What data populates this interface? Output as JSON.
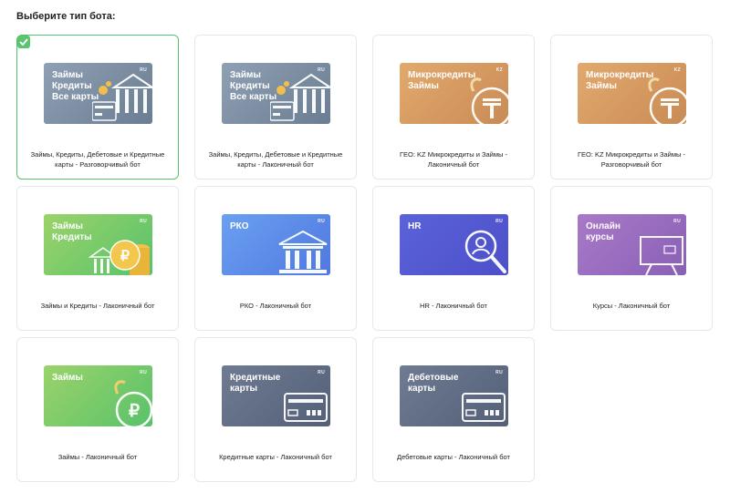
{
  "page": {
    "title": "Выберите тип бота:"
  },
  "colors": {
    "selected_border": "#57c26a",
    "check_bg": "#5cc36f"
  },
  "cards": [
    {
      "banner_title": "Займы\nКредиты\nВсе карты",
      "tag": "RU",
      "caption": "Займы, Кредиты, Дебетовые и Кредитные карты - Разговорчивый бот",
      "theme": "slate",
      "icon": "bank-card-coin-icon",
      "selected": true
    },
    {
      "banner_title": "Займы\nКредиты\nВсе карты",
      "tag": "RU",
      "caption": "Займы, Кредиты, Дебетовые и Кредитные карты - Лаконичный бот",
      "theme": "slate",
      "icon": "bank-card-coin-icon",
      "selected": false
    },
    {
      "banner_title": "Микрокредиты\nЗаймы",
      "tag": "KZ",
      "caption": "ГЕО: KZ Микрокредиты и Займы - Лаконичный бот",
      "theme": "orange",
      "icon": "tenge-coin-icon",
      "selected": false
    },
    {
      "banner_title": "Микрокредиты\nЗаймы",
      "tag": "KZ",
      "caption": "ГЕО: KZ Микрокредиты и Займы - Разговорчивый бот",
      "theme": "orange",
      "icon": "tenge-coin-icon",
      "selected": false
    },
    {
      "banner_title": "Займы\nКредиты",
      "tag": "RU",
      "caption": "Займы и Кредиты - Лаконичный бот",
      "theme": "green",
      "icon": "ruble-coin-stack-icon",
      "selected": false
    },
    {
      "banner_title": "РКО",
      "tag": "RU",
      "caption": "РКО - Лаконичный бот",
      "theme": "blue",
      "icon": "bank-building-icon",
      "selected": false
    },
    {
      "banner_title": "HR",
      "tag": "RU",
      "caption": "HR - Лаконичный бот",
      "theme": "indigo",
      "icon": "magnifier-person-icon",
      "selected": false
    },
    {
      "banner_title": "Онлайн\nкурсы",
      "tag": "RU",
      "caption": "Курсы - Лаконичный бот",
      "theme": "purple",
      "icon": "presentation-board-icon",
      "selected": false
    },
    {
      "banner_title": "Займы",
      "tag": "RU",
      "caption": "Займы - Лаконичный бот",
      "theme": "green",
      "icon": "ruble-coin-icon",
      "selected": false
    },
    {
      "banner_title": "Кредитные\nкарты",
      "tag": "RU",
      "caption": "Кредитные карты - Лаконичный бот",
      "theme": "dark",
      "icon": "credit-card-icon",
      "selected": false
    },
    {
      "banner_title": "Дебетовые\nкарты",
      "tag": "RU",
      "caption": "Дебетовые карты - Лаконичный бот",
      "theme": "dark",
      "icon": "debit-card-icon",
      "selected": false
    }
  ]
}
